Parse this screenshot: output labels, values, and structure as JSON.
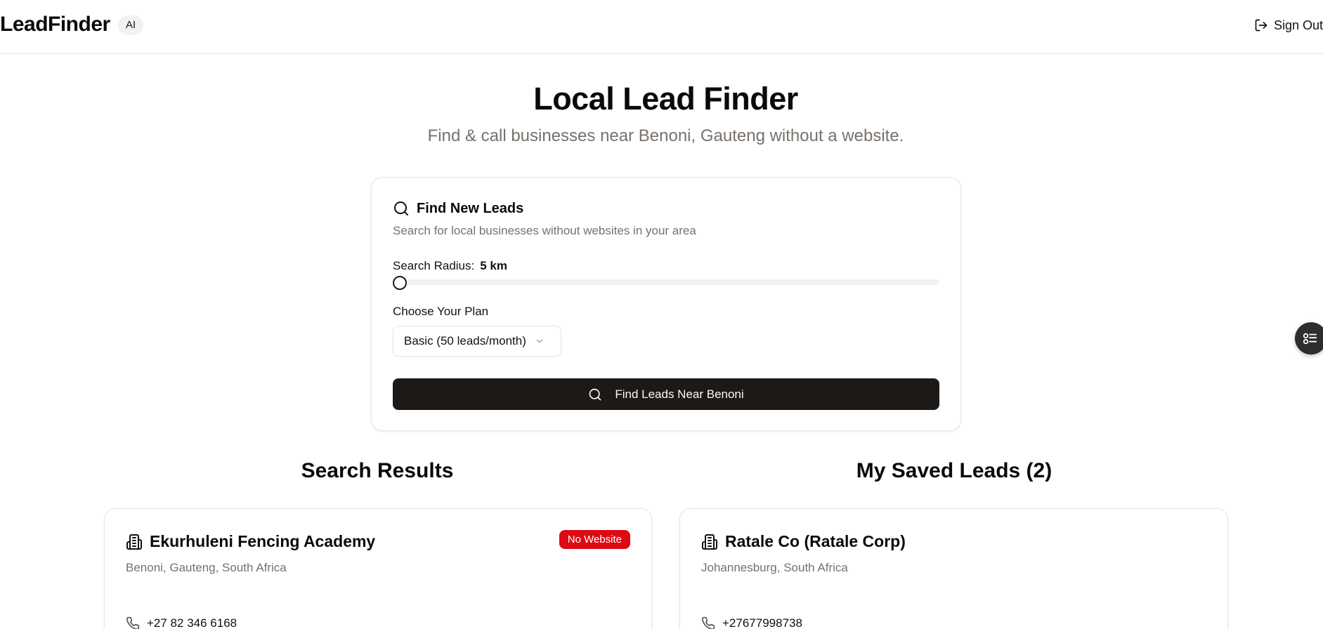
{
  "header": {
    "brand": "LeadFinder",
    "badge": "AI",
    "sign_out": "Sign Out"
  },
  "hero": {
    "title": "Local Lead Finder",
    "subtitle": "Find & call businesses near Benoni, Gauteng without a website."
  },
  "search_card": {
    "title": "Find New Leads",
    "description": "Search for local businesses without websites in your area",
    "radius_label": "Search Radius:",
    "radius_value": "5 km",
    "radius_fraction": 0,
    "plan_label": "Choose Your Plan",
    "plan_selected": "Basic (50 leads/month)",
    "button_label": "Find Leads Near Benoni"
  },
  "results": {
    "title": "Search Results",
    "items": [
      {
        "name": "Ekurhuleni Fencing Academy",
        "location": "Benoni, Gauteng, South Africa",
        "badge": "No Website",
        "phone": "+27 82 346 6168"
      }
    ]
  },
  "saved": {
    "title": "My Saved Leads (2)",
    "items": [
      {
        "name": "Ratale Co (Ratale Corp)",
        "location": "Johannesburg, South Africa",
        "phone": "+27677998738"
      }
    ]
  },
  "icons": {
    "sign_out": "log-out-icon",
    "search": "search-icon",
    "building": "building-icon",
    "phone": "phone-icon",
    "chevron": "chevron-down-icon",
    "fab": "list-settings-icon"
  },
  "colors": {
    "primary": "#1c1917",
    "badge_red": "#dc0a13",
    "muted_text": "#78716c",
    "border": "#e7e5e4"
  }
}
